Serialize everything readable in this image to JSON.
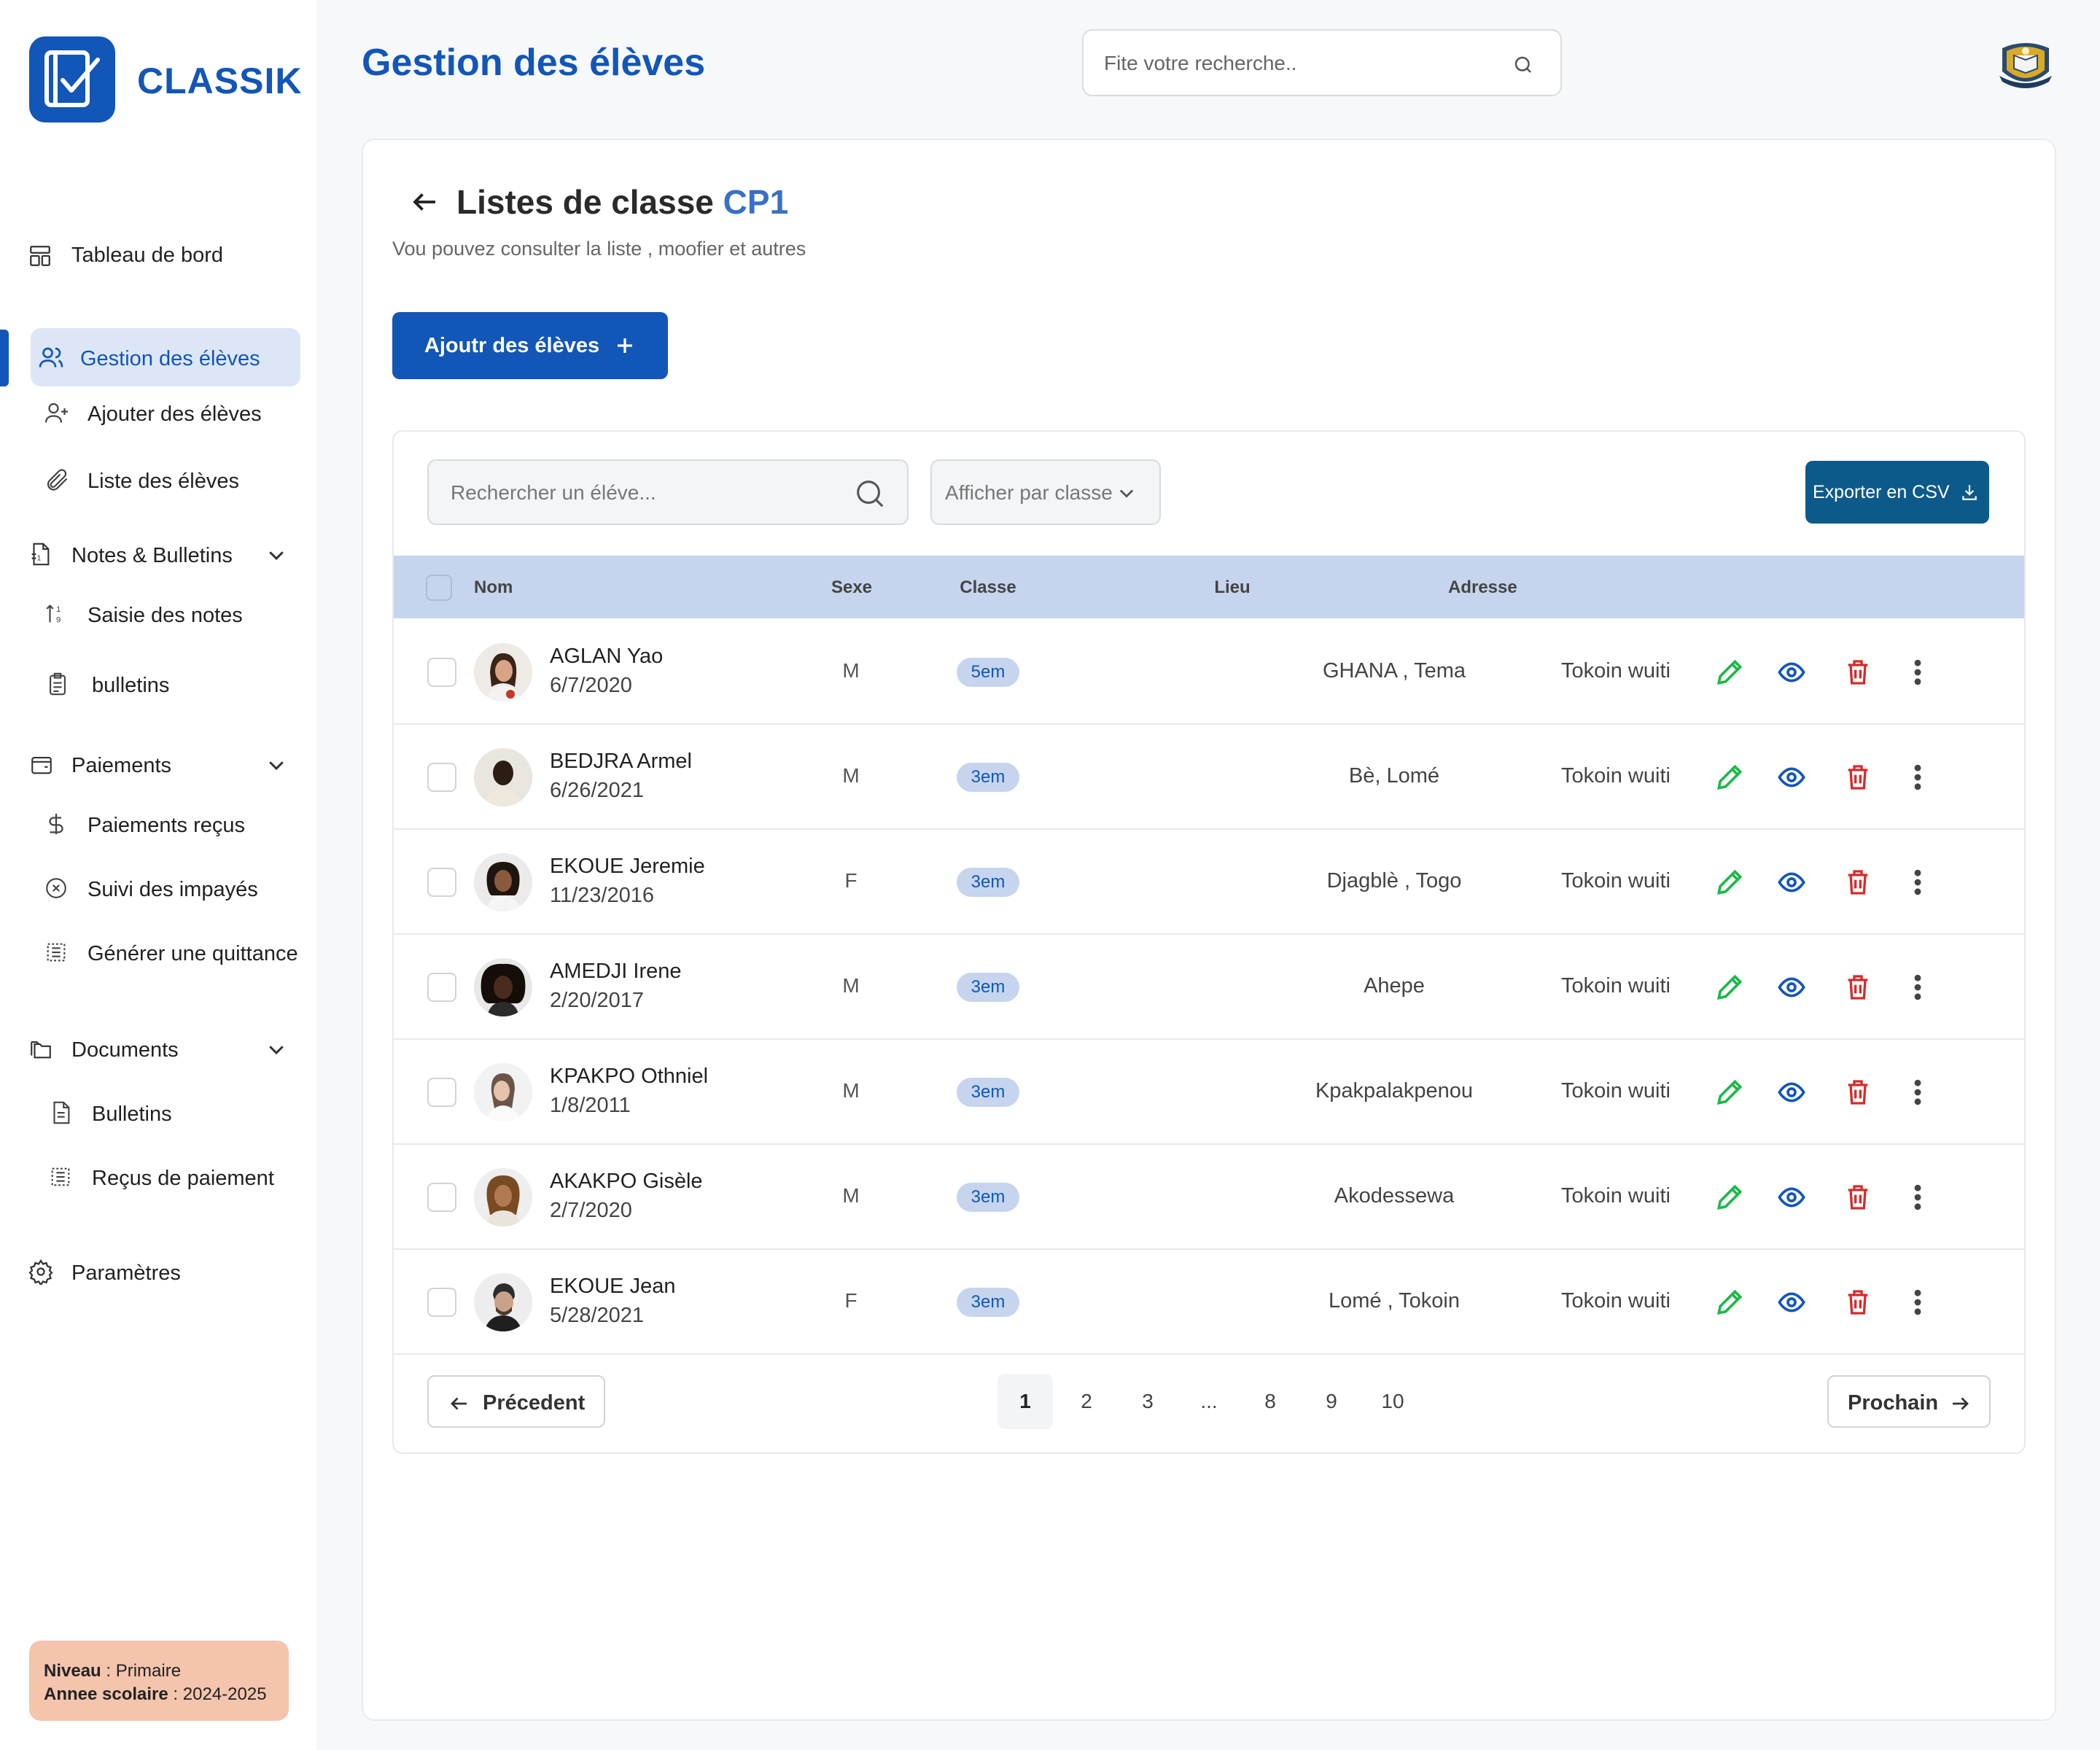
{
  "app": {
    "name": "CLASSIK",
    "page_title": "Gestion des élèves"
  },
  "search": {
    "placeholder": "Fite votre recherche.."
  },
  "sidebar": {
    "dashboard": "Tableau de bord",
    "students_group": "Gestion des élèves",
    "add_students": "Ajouter des élèves",
    "list_students": "Liste des  élèves",
    "grades_group": "Notes & Bulletins",
    "enter_grades": "Saisie des notes",
    "bulletins": "bulletins",
    "payments_group": "Paiements",
    "payments_received": "Paiements reçus",
    "unpaid_tracking": "Suivi des impayés",
    "generate_receipt": "Générer une quittance",
    "documents_group": "Documents",
    "doc_bulletins": "Bulletins",
    "doc_receipts": "Reçus de paiement",
    "settings": "Paramètres"
  },
  "level": {
    "level_label": "Niveau",
    "level_value": "Primaire",
    "year_label": "Annee scolaire",
    "year_value": "2024-2025"
  },
  "list": {
    "title": "Listes de classe",
    "class_name": "CP1",
    "subtitle": "Vou pouvez consulter la liste , moofier et autres",
    "add_button": "Ajoutr des élèves",
    "search_placeholder": "Rechercher un éléve...",
    "class_filter": "Afficher par classe",
    "export_button": "Exporter en CSV"
  },
  "table": {
    "headers": {
      "name": "Nom",
      "sex": "Sexe",
      "class": "Classe",
      "place": "Lieu",
      "address": "Adresse"
    },
    "rows": [
      {
        "name": "AGLAN Yao",
        "dob": "6/7/2020",
        "sex": "M",
        "class": "5em",
        "place": "GHANA , Tema",
        "address": "Tokoin wuiti"
      },
      {
        "name": "BEDJRA Armel",
        "dob": "6/26/2021",
        "sex": "M",
        "class": "3em",
        "place": "Bè, Lomé",
        "address": "Tokoin wuiti"
      },
      {
        "name": "EKOUE Jeremie",
        "dob": "11/23/2016",
        "sex": "F",
        "class": "3em",
        "place": "Djagblè , Togo",
        "address": "Tokoin wuiti"
      },
      {
        "name": "AMEDJI Irene",
        "dob": "2/20/2017",
        "sex": "M",
        "class": "3em",
        "place": "Ahepe",
        "address": "Tokoin wuiti"
      },
      {
        "name": "KPAKPO Othniel",
        "dob": "1/8/2011",
        "sex": "M",
        "class": "3em",
        "place": "Kpakpalakpenou",
        "address": "Tokoin wuiti"
      },
      {
        "name": "AKAKPO Gisèle",
        "dob": "2/7/2020",
        "sex": "M",
        "class": "3em",
        "place": "Akodessewa",
        "address": "Tokoin wuiti"
      },
      {
        "name": "EKOUE Jean",
        "dob": "5/28/2021",
        "sex": "F",
        "class": "3em",
        "place": "Lomé , Tokoin",
        "address": "Tokoin wuiti"
      }
    ]
  },
  "pagination": {
    "prev": "Précedent",
    "next": "Prochain",
    "pages": [
      "1",
      "2",
      "3",
      "...",
      "8",
      "9",
      "10"
    ],
    "current": "1"
  },
  "colors": {
    "primary": "#1256b8",
    "header_row": "#c6d5ed",
    "edit": "#1db84a",
    "view": "#1256b8",
    "delete": "#d62b2b",
    "csv": "#0d5a8a"
  }
}
